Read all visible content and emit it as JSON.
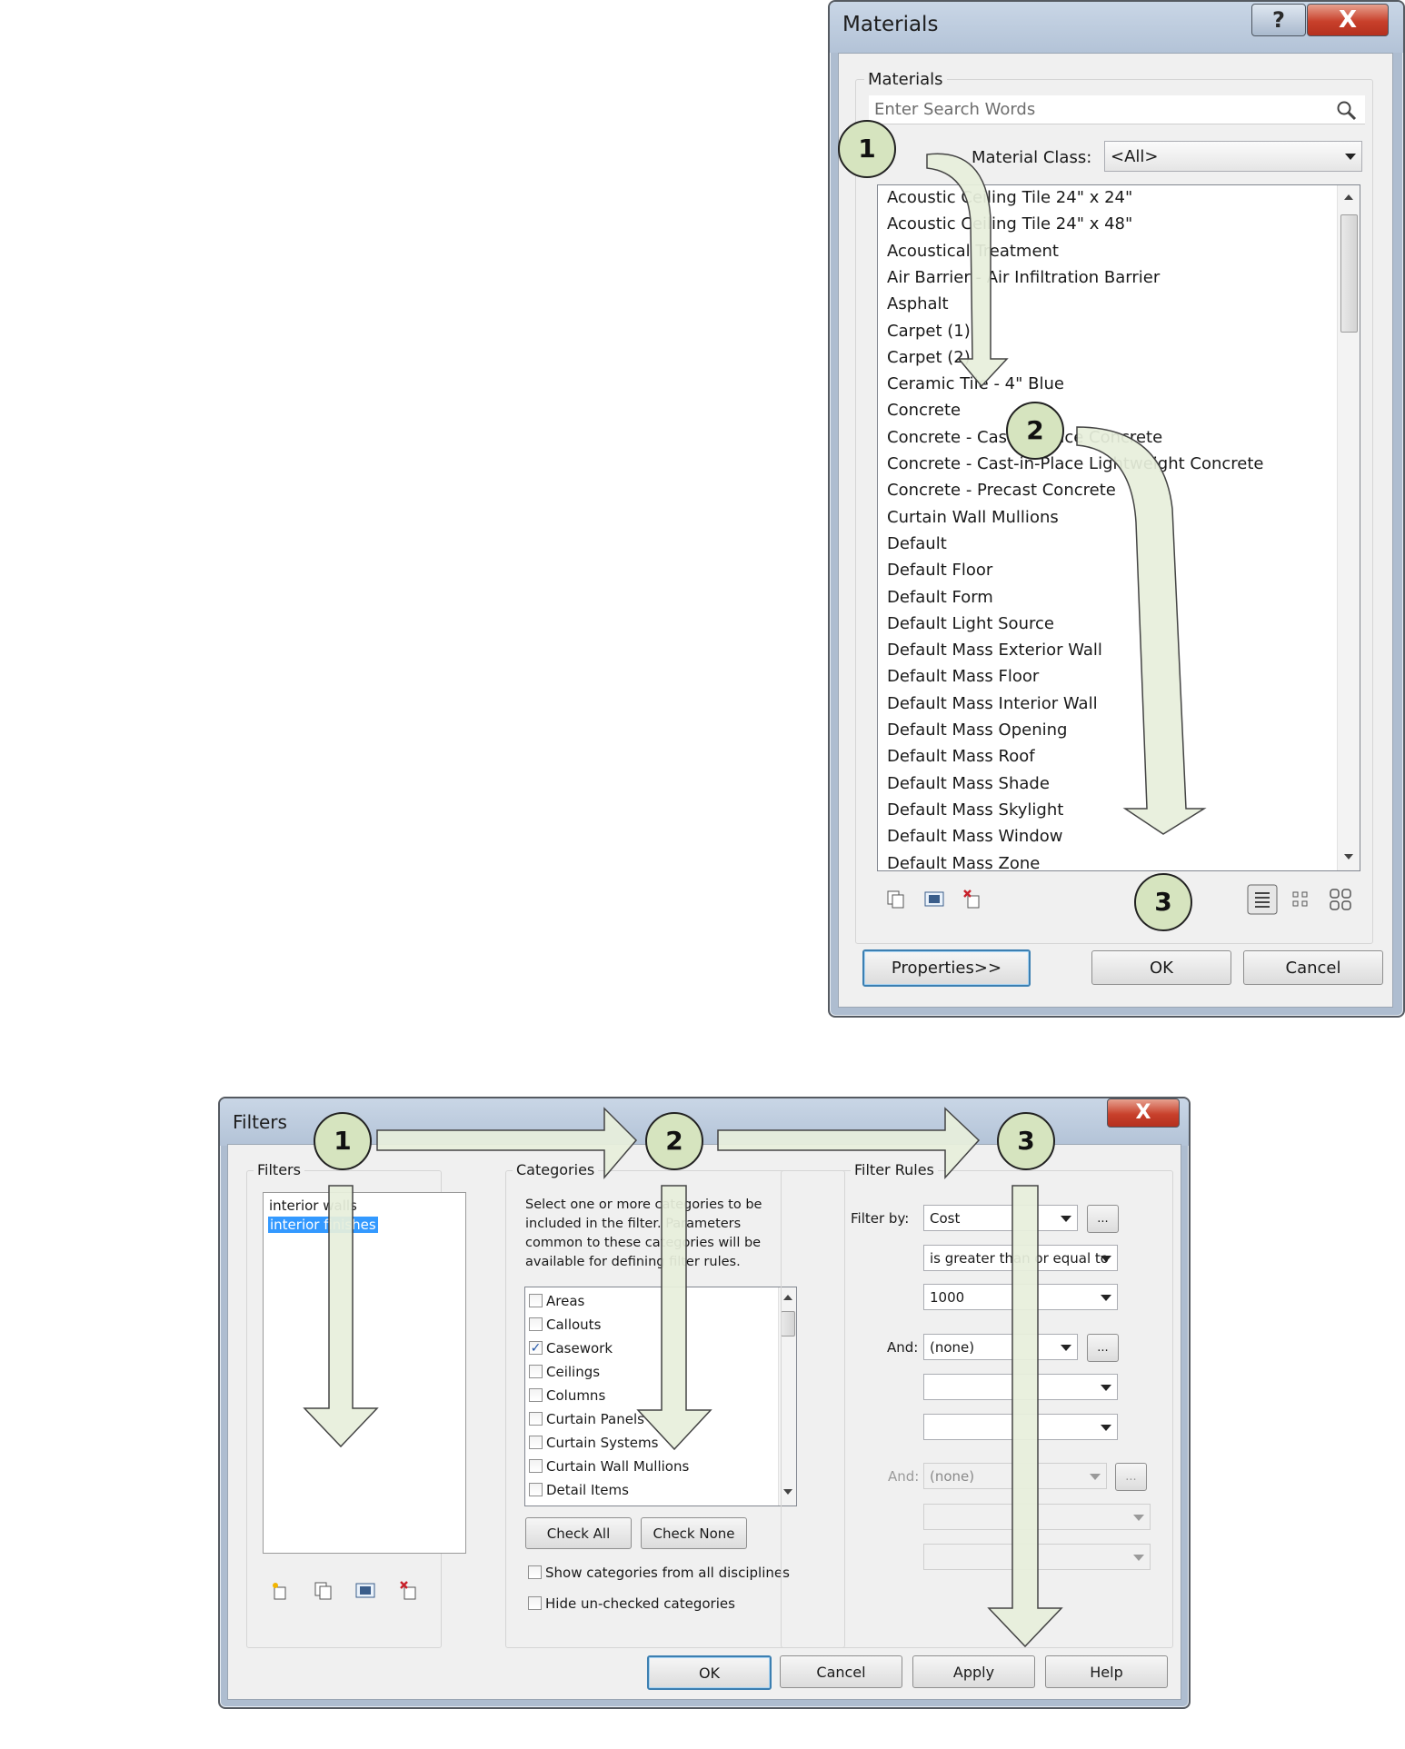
{
  "materials_dialog": {
    "title": "Materials",
    "help_glyph": "?",
    "close_glyph": "X",
    "group_label": "Materials",
    "search_placeholder": "Enter Search Words",
    "material_class_label": "Material Class:",
    "material_class_value": "<All>",
    "items": [
      "Acoustic Ceiling Tile 24\" x 24\"",
      "Acoustic Ceiling Tile 24\" x 48\"",
      "Acoustical Treatment",
      "Air Barrier - Air Infiltration Barrier",
      "Asphalt",
      "Carpet (1)",
      "Carpet (2)",
      "Ceramic Tile - 4\" Blue",
      "Concrete",
      "Concrete - Cast-in-Place Concrete",
      "Concrete - Cast-in-Place Lightweight Concrete",
      "Concrete - Precast Concrete",
      "Curtain Wall Mullions",
      "Default",
      "Default Floor",
      "Default Form",
      "Default Light Source",
      "Default Mass Exterior Wall",
      "Default Mass Floor",
      "Default Mass Interior Wall",
      "Default Mass Opening",
      "Default Mass Roof",
      "Default Mass Shade",
      "Default Mass Skylight",
      "Default Mass Window",
      "Default Mass Zone"
    ],
    "properties_button": "Properties>>",
    "ok_button": "OK",
    "cancel_button": "Cancel"
  },
  "filters_dialog": {
    "title": "Filters",
    "close_glyph": "X",
    "filters_group": "Filters",
    "filters": [
      "interior walls",
      "interior finishes"
    ],
    "categories_group": "Categories",
    "categories_help": [
      "Select one or more categories to be",
      "included in the filter. Parameters",
      "common to these categories will be",
      "available for defining filter rules."
    ],
    "categories": [
      {
        "label": "Areas",
        "checked": false
      },
      {
        "label": "Callouts",
        "checked": false
      },
      {
        "label": "Casework",
        "checked": true
      },
      {
        "label": "Ceilings",
        "checked": false
      },
      {
        "label": "Columns",
        "checked": false
      },
      {
        "label": "Curtain Panels",
        "checked": false
      },
      {
        "label": "Curtain Systems",
        "checked": false
      },
      {
        "label": "Curtain Wall Mullions",
        "checked": false
      },
      {
        "label": "Detail Items",
        "checked": false
      }
    ],
    "check_mark": "✓",
    "check_all_button": "Check All",
    "check_none_button": "Check None",
    "show_all_disciplines": "Show categories from all disciplines",
    "hide_unchecked": "Hide un-checked categories",
    "rules_group": "Filter Rules",
    "filter_by_label": "Filter by:",
    "filter_by_value": "Cost",
    "operator_value": "is greater than or equal to",
    "value_field": "1000",
    "and_label_1": "And:",
    "and_value_1": "(none)",
    "and_label_2": "And:",
    "and_value_2": "(none)",
    "ellipsis": "...",
    "ok_button": "OK",
    "cancel_button": "Cancel",
    "apply_button": "Apply",
    "help_button": "Help"
  },
  "callouts": {
    "materials": [
      "1",
      "2",
      "3"
    ],
    "filters": [
      "1",
      "2",
      "3"
    ]
  },
  "colors": {
    "callout_fill": "#d6e4bf",
    "arrow_fill": "#e7efdc",
    "selection_blue": "#3399ff"
  }
}
